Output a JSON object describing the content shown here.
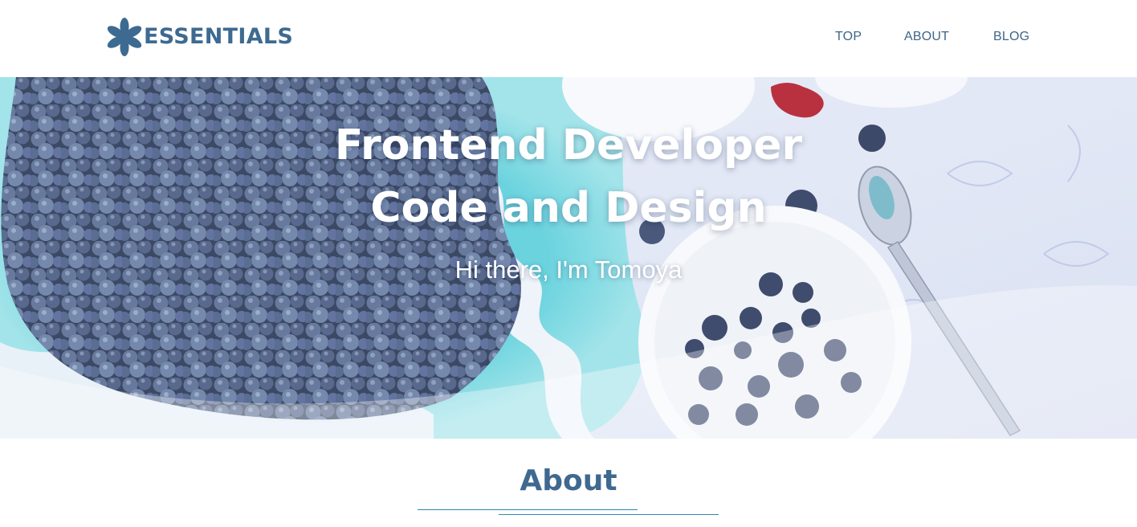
{
  "header": {
    "logo_text": "ESSENTIALS",
    "logo_icon": "flower-asterisk-icon",
    "nav": [
      {
        "label": "TOP"
      },
      {
        "label": "ABOUT"
      },
      {
        "label": "BLOG"
      }
    ]
  },
  "hero": {
    "title_line1": "Frontend Developer",
    "title_line2": "Code and Design",
    "subtitle": "Hi there, I'm Tomoya",
    "background": "blueberries-photo"
  },
  "about": {
    "heading": "About"
  },
  "colors": {
    "brand": "#3d6a91",
    "nav": "#3e6688",
    "divider": "#2e89b3",
    "hero_text": "#ffffff"
  }
}
